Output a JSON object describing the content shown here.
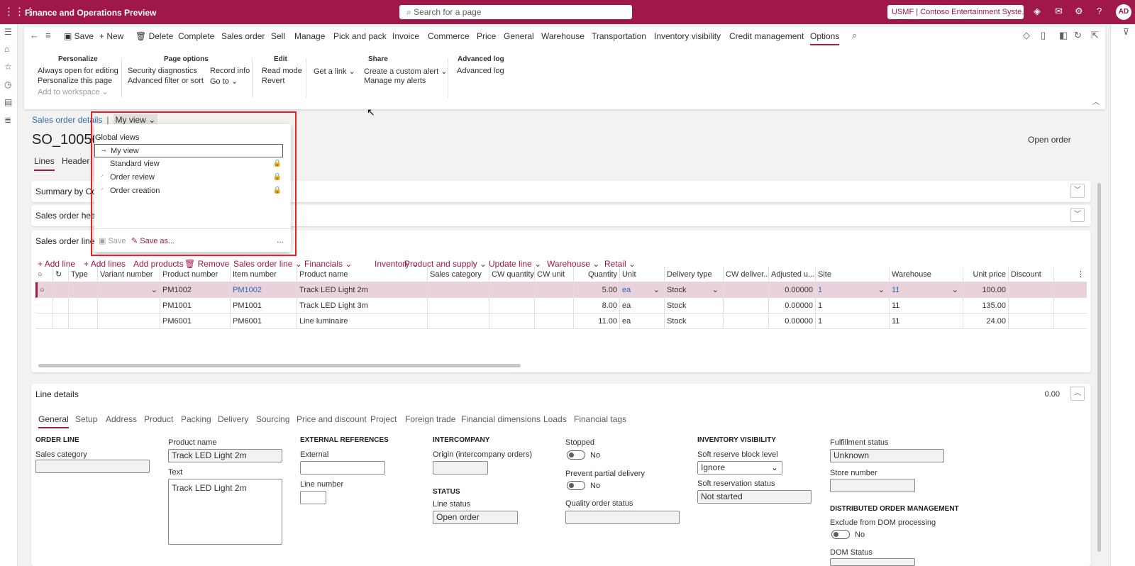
{
  "app": {
    "title": "Finance and Operations Preview",
    "search_placeholder": "Search for a page",
    "company": "USMF | Contoso Entertainment Syste...",
    "avatar": "AD"
  },
  "actionpane": {
    "tabs": [
      "Save",
      "New",
      "Delete",
      "Complete",
      "Sales order",
      "Sell",
      "Manage",
      "Pick and pack",
      "Invoice",
      "Commerce",
      "Price",
      "General",
      "Warehouse",
      "Transportation",
      "Inventory visibility",
      "Credit management",
      "Options"
    ],
    "active_tab": "Options",
    "groups": {
      "personalize": {
        "title": "Personalize",
        "items": [
          "Always open for editing",
          "Personalize this page",
          "Add to workspace"
        ]
      },
      "page_options": {
        "title": "Page options",
        "col1": [
          "Security diagnostics",
          "Advanced filter or sort"
        ],
        "col2": [
          "Record info",
          "Go to"
        ]
      },
      "edit": {
        "title": "Edit",
        "items": [
          "Read mode",
          "Revert"
        ]
      },
      "share": {
        "title": "Share",
        "get_link": "Get a link",
        "items": [
          "Create a custom alert",
          "Manage my alerts"
        ]
      },
      "advanced_log": {
        "title": "Advanced log",
        "items": [
          "Advanced log"
        ]
      }
    }
  },
  "breadcrumb": {
    "page": "Sales order details",
    "view": "My view"
  },
  "record": {
    "id": "SO_10056",
    "status": "Open order"
  },
  "page_tabs": [
    "Lines",
    "Header"
  ],
  "fasttabs": {
    "summary": "Summary by Co",
    "header": "Sales order head",
    "lines": "Sales order lines",
    "details": "Line details",
    "details_value": "0.00"
  },
  "lines_toolbar": [
    "Add line",
    "Add lines",
    "Add products",
    "Remove",
    "Sales order line",
    "Financials",
    "Inventory",
    "Product and supply",
    "Update line",
    "Warehouse",
    "Retail"
  ],
  "grid": {
    "columns": [
      "Type",
      "Variant number",
      "Product number",
      "Item number",
      "Product name",
      "Sales category",
      "CW quantity",
      "CW unit",
      "Quantity",
      "Unit",
      "Delivery type",
      "CW deliver...",
      "Adjusted u...",
      "Site",
      "Warehouse",
      "Unit price",
      "Discount"
    ],
    "rows": [
      {
        "product_number": "PM1002",
        "item_number": "PM1002",
        "product_name": "Track LED Light 2m",
        "quantity": "5.00",
        "unit": "ea",
        "delivery_type": "Stock",
        "adjusted": "0.00000",
        "site": "1",
        "warehouse": "11",
        "unit_price": "100.00"
      },
      {
        "product_number": "PM1001",
        "item_number": "PM1001",
        "product_name": "Track LED Light 3m",
        "quantity": "8.00",
        "unit": "ea",
        "delivery_type": "Stock",
        "adjusted": "0.00000",
        "site": "1",
        "warehouse": "11",
        "unit_price": "135.00"
      },
      {
        "product_number": "PM6001",
        "item_number": "PM6001",
        "product_name": "Line luminaire",
        "quantity": "11.00",
        "unit": "ea",
        "delivery_type": "Stock",
        "adjusted": "0.00000",
        "site": "1",
        "warehouse": "11",
        "unit_price": "24.00"
      }
    ]
  },
  "detail_tabs": [
    "General",
    "Setup",
    "Address",
    "Product",
    "Packing",
    "Delivery",
    "Sourcing",
    "Price and discount",
    "Project",
    "Foreign trade",
    "Financial dimensions",
    "Loads",
    "Financial tags"
  ],
  "details": {
    "order_line_head": "ORDER LINE",
    "sales_category_label": "Sales category",
    "product_name_label": "Product name",
    "product_name": "Track LED Light 2m",
    "text_label": "Text",
    "text": "Track LED Light 2m",
    "ext_ref_head": "EXTERNAL REFERENCES",
    "external_label": "External",
    "line_number_label": "Line number",
    "intercompany_head": "INTERCOMPANY",
    "origin_label": "Origin (intercompany orders)",
    "status_head": "STATUS",
    "line_status_label": "Line status",
    "line_status": "Open order",
    "stopped_label": "Stopped",
    "stopped": "No",
    "prevent_label": "Prevent partial delivery",
    "prevent": "No",
    "quality_label": "Quality order status",
    "inv_vis_head": "INVENTORY VISIBILITY",
    "soft_block_label": "Soft reserve block level",
    "soft_block": "Ignore",
    "soft_status_label": "Soft reservation status",
    "soft_status": "Not started",
    "fulfillment_label": "Fulfillment status",
    "fulfillment": "Unknown",
    "store_label": "Store number",
    "dom_head": "DISTRIBUTED ORDER MANAGEMENT",
    "exclude_dom_label": "Exclude from DOM processing",
    "exclude_dom": "No",
    "dom_status_label": "DOM Status"
  },
  "view_panel": {
    "global_views": "Global views",
    "views": [
      "My view",
      "Standard view",
      "Order review",
      "Order creation"
    ],
    "save": "Save",
    "save_as": "Save as...",
    "more": "..."
  },
  "colors": {
    "brand": "#a0184a",
    "highlight_box": "#e3242b",
    "link": "#2b6cb0"
  }
}
